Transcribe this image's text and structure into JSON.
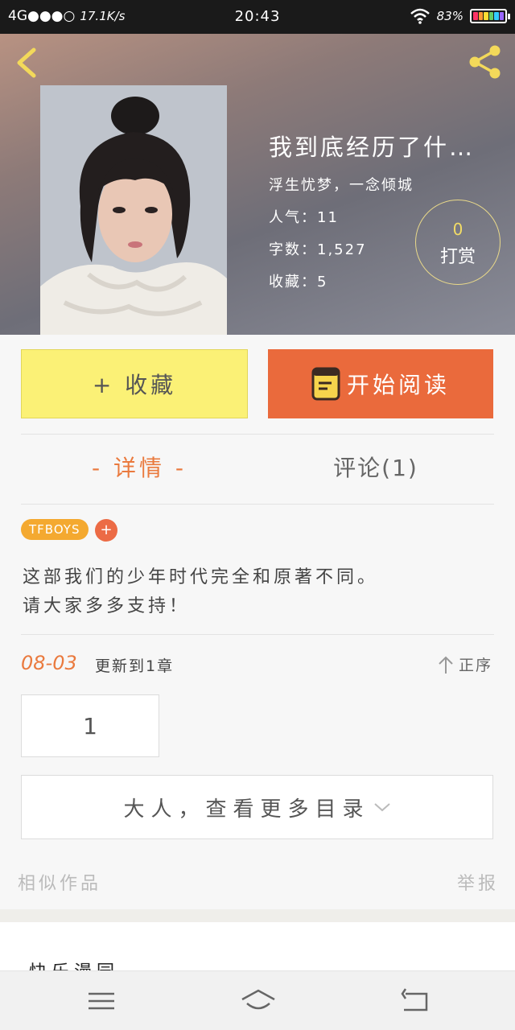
{
  "status_bar": {
    "network": "4G",
    "speed": "17.1K/s",
    "time": "20:43",
    "battery": "83%"
  },
  "icons": {
    "back": "chevron-left-icon",
    "share": "share-icon",
    "book": "book-icon",
    "sort": "arrow-up-icon",
    "expand": "chevron-down-icon"
  },
  "colors": {
    "accent_orange": "#ea6a3c",
    "collect_yellow": "#fbf176",
    "tag_orange": "#f4a930",
    "icon_yellow": "#f2dc66"
  },
  "book": {
    "title": "我到底经历了什…",
    "subtitle": "浮生忧梦，一念倾城",
    "popularity": "人气：11",
    "word_count": "字数：1,527",
    "favorites": "收藏：5"
  },
  "reward": {
    "count": "0",
    "label": "打赏"
  },
  "actions": {
    "collect_label": "+ 收藏",
    "read_label": "开始阅读"
  },
  "tabs": {
    "detail": "- 详情 -",
    "comment": "评论(1)"
  },
  "tag": {
    "label": "TFBOYS",
    "add_label": "+"
  },
  "description": {
    "line1": "这部我们的少年时代完全和原著不同。",
    "line2": "请大家多多支持！"
  },
  "update": {
    "date": "08-03",
    "text": "更新到1章",
    "sort_label": "正序"
  },
  "chapters": {
    "first": "1",
    "more_label": "大人，查看更多目录"
  },
  "footer": {
    "similar_label": "相似作品",
    "report_label": "举报",
    "card_text": "快乐漫园"
  }
}
